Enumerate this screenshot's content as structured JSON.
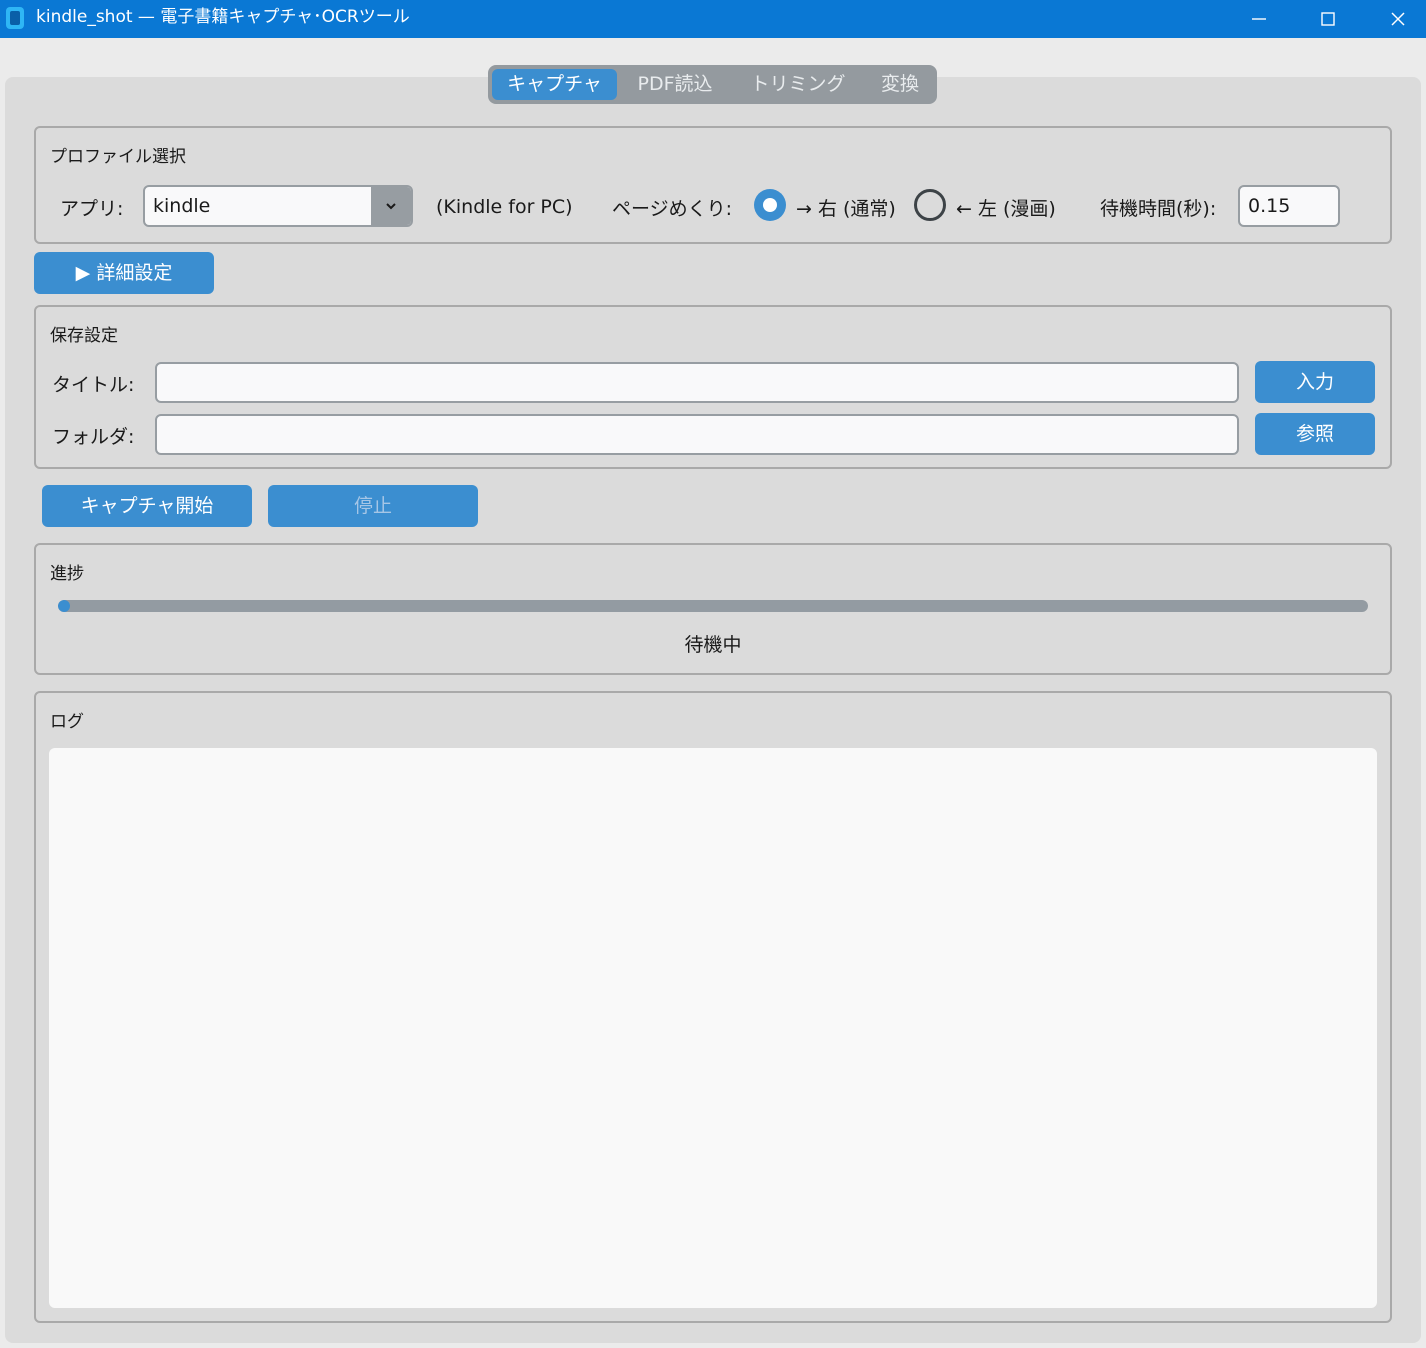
{
  "window": {
    "title": "kindle_shot — 電子書籍キャプチャ･OCRツール"
  },
  "tabs": [
    {
      "label": "キャプチャ",
      "active": true
    },
    {
      "label": "PDF読込",
      "active": false
    },
    {
      "label": "トリミング",
      "active": false
    },
    {
      "label": "変換",
      "active": false
    }
  ],
  "profile": {
    "section_title": "プロファイル選択",
    "app_label": "アプリ:",
    "app_value": "kindle",
    "app_note": "(Kindle for PC)",
    "page_turn_label": "ページめくり:",
    "page_turn_options": [
      {
        "label": "→ 右 (通常)",
        "selected": true
      },
      {
        "label": "← 左 (漫画)",
        "selected": false
      }
    ],
    "wait_label": "待機時間(秒):",
    "wait_value": "0.15"
  },
  "advanced_button": "▶ 詳細設定",
  "save": {
    "section_title": "保存設定",
    "title_label": "タイトル:",
    "title_value": "",
    "title_button": "入力",
    "folder_label": "フォルダ:",
    "folder_value": "",
    "folder_button": "参照"
  },
  "actions": {
    "start": "キャプチャ開始",
    "stop": "停止",
    "stop_enabled": false
  },
  "progress": {
    "section_title": "進捗",
    "value_fraction": 0.0,
    "status": "待機中"
  },
  "log": {
    "section_title": "ログ",
    "content": ""
  },
  "colors": {
    "titlebar": "#0a78d4",
    "accent": "#3b8ed0",
    "panel": "#dbdbdb"
  }
}
